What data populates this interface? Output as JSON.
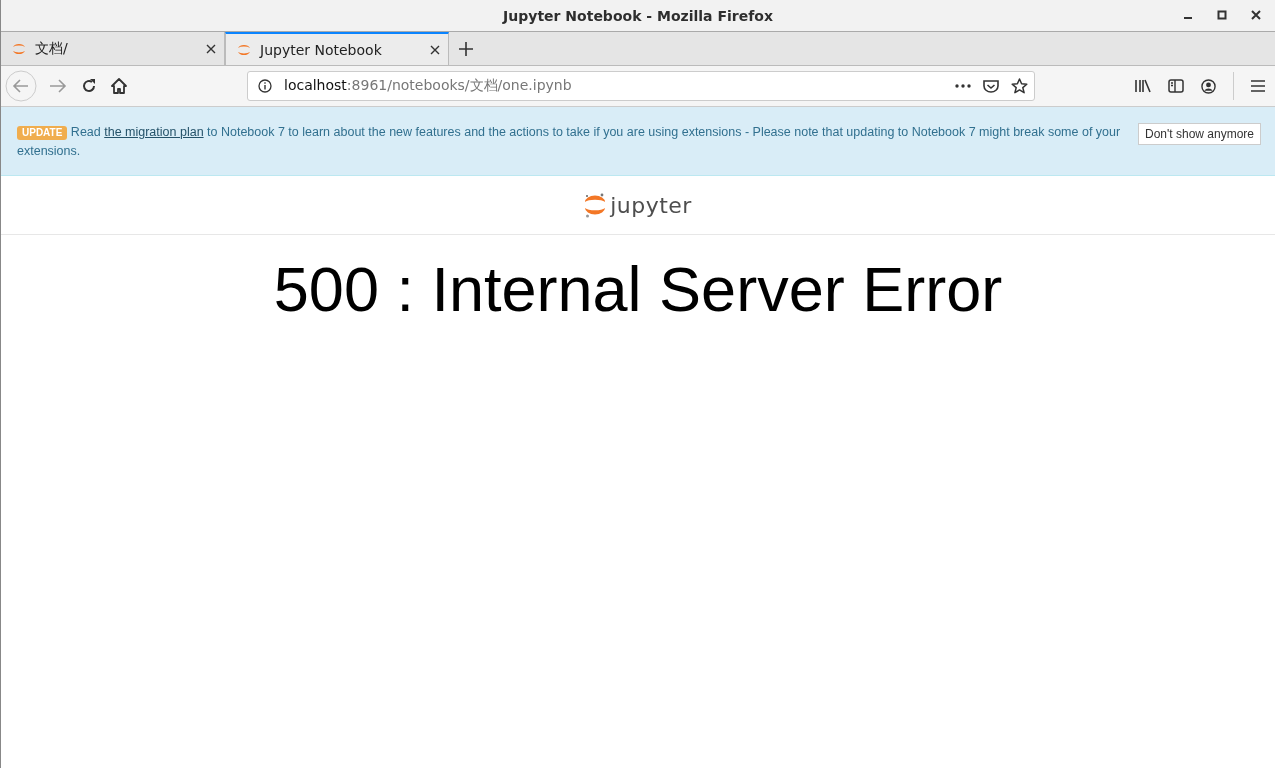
{
  "window": {
    "title": "Jupyter Notebook - Mozilla Firefox"
  },
  "tabs": [
    {
      "label": "文档/",
      "selected": false
    },
    {
      "label": "Jupyter Notebook",
      "selected": true
    }
  ],
  "address_bar": {
    "host": "localhost",
    "path": ":8961/notebooks/文档/one.ipynb"
  },
  "banner": {
    "badge": "UPDATE",
    "text_before": "Read",
    "link": "the migration plan",
    "text_after": "to Notebook 7 to learn about the new features and the actions to take if you are using extensions - Please note that updating to Notebook 7 might break some of your extensions.",
    "button": "Don't show anymore"
  },
  "header": {
    "logo_text": "jupyter"
  },
  "error": {
    "heading": "500 : Internal Server Error"
  }
}
